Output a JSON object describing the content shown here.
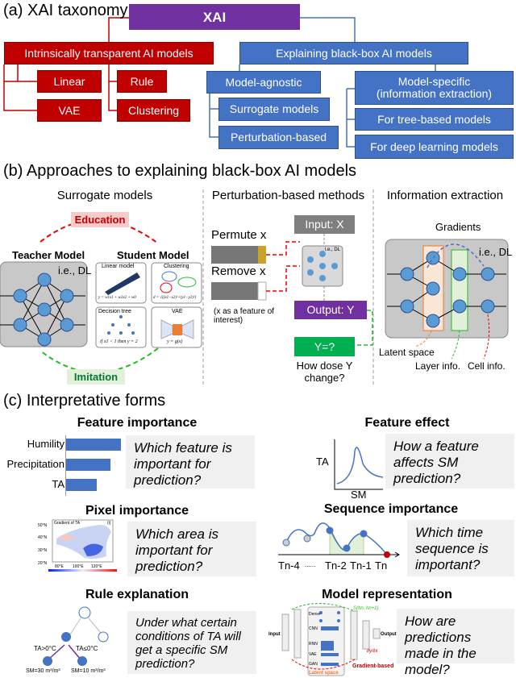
{
  "a": {
    "title": "(a) XAI taxonomy",
    "root": "XAI",
    "intrinsic": "Intrinsically transparent AI models",
    "linear": "Linear",
    "rule": "Rule",
    "vae": "VAE",
    "clustering": "Clustering",
    "blackbox": "Explaining black-box AI models",
    "agnostic": "Model-agnostic",
    "surrogate": "Surrogate models",
    "perturbation": "Perturbation-based",
    "specific": "Model-specific (information extraction)",
    "tree": "For tree-based models",
    "deep": "For deep learning models"
  },
  "b": {
    "title": "(b) Approaches to explaining black-box AI models",
    "surrogate": {
      "title": "Surrogate models",
      "education": "Education",
      "imitation": "Imitation",
      "teacher": "Teacher Model",
      "student": "Student Model",
      "ie": "i.e., DL",
      "cells": [
        "Linear model",
        "Clustering",
        "Decision tree",
        "VAE"
      ],
      "formulas": [
        "y = w1x1 + w2x2 + w0",
        "d = √((x1−x2)²+(y1−y2)²)",
        "if x1 < 1 then y = 2",
        "y = g(x)"
      ]
    },
    "perturbation": {
      "title": "Perturbation-based methods",
      "permute": "Permute x",
      "remove": "Remove x",
      "note": "(x as a feature of interest)",
      "input": "Input: X",
      "output": "Output: Y",
      "ie": "i.e., DL",
      "yq": "Y=?",
      "question": "How dose Y change?"
    },
    "info": {
      "title": "Information extraction",
      "gradients": "Gradients",
      "ie": "i.e., DL",
      "latent": "Latent space",
      "layer": "Layer info.",
      "cell": "Cell info."
    }
  },
  "c": {
    "title": "(c) Interpretative forms",
    "feature_importance": {
      "title": "Feature importance",
      "categories": [
        "Humility",
        "Precipitation",
        "TA"
      ],
      "values": [
        1.0,
        0.81,
        0.56
      ],
      "question": "Which feature is important for prediction?"
    },
    "feature_effect": {
      "title": "Feature effect",
      "ylabel": "TA",
      "xlabel": "SM",
      "question": "How a feature affects SM prediction?"
    },
    "pixel_importance": {
      "title": "Pixel importance",
      "map_title": "Gradient of TA",
      "panel": "(i)",
      "lat_ticks": [
        "50°N",
        "40°N",
        "30°N",
        "20°N"
      ],
      "lon_ticks": [
        "80°E",
        "100°E",
        "120°E"
      ],
      "question": "Which area is important for prediction?"
    },
    "sequence_importance": {
      "title": "Sequence importance",
      "ticks": [
        "Tn-4",
        "......",
        "Tn-2",
        "Tn-1",
        "Tn"
      ],
      "question": "Which time sequence is important?"
    },
    "rule_explanation": {
      "title": "Rule explanation",
      "left_cond": "TA>0°C",
      "right_cond": "TA≤0°C",
      "left_leaf": "SM=30 m³/m³",
      "right_leaf": "SM=10 m³/m³",
      "question": "Under what certain conditions of TA will get a specific SM prediction?"
    },
    "model_representation": {
      "title": "Model representation",
      "input": "Input",
      "output": "Output",
      "layers": [
        "Dense",
        "CNN",
        "RNN",
        "VAE",
        "GAN"
      ],
      "similarity": "S(hn, hn+1)",
      "grad": "∂y/∂x",
      "gradient_based": "Gradient-based",
      "latent": "Latent space",
      "question": "How are predictions made in the model?"
    }
  },
  "colors": {
    "purple": "#7030A0",
    "red": "#C00000",
    "blue": "#4472C4",
    "node": "#5B9BD5",
    "green": "#00B050"
  }
}
